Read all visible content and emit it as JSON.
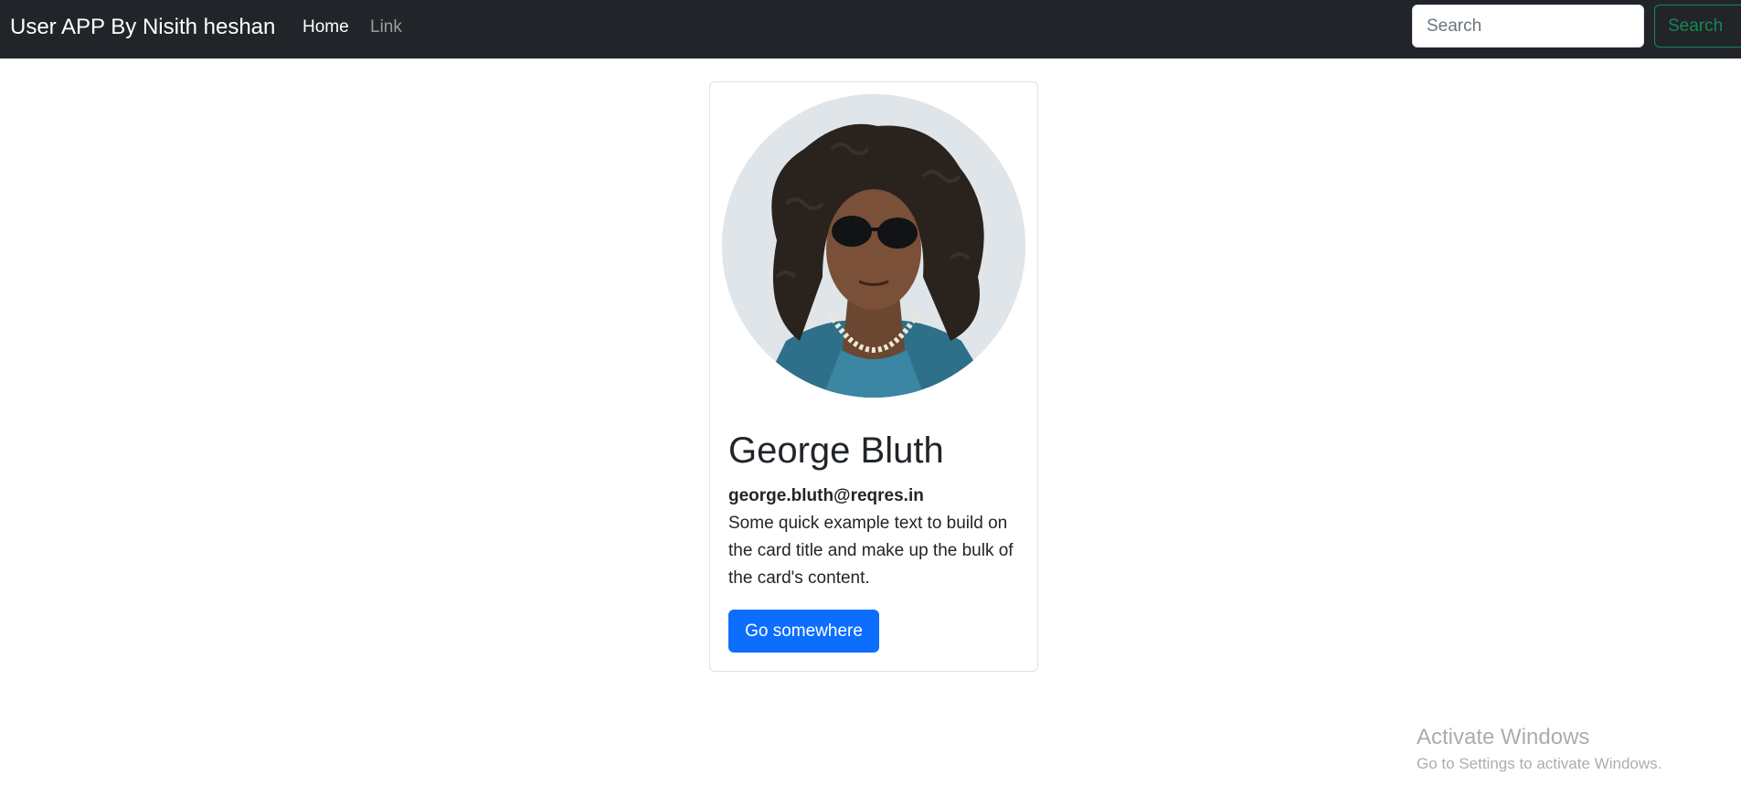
{
  "navbar": {
    "brand": "User APP By Nisith heshan",
    "links": [
      {
        "label": "Home",
        "active": true
      },
      {
        "label": "Link",
        "active": false
      }
    ],
    "search": {
      "placeholder": "Search",
      "value": "",
      "button_label": "Search"
    }
  },
  "card": {
    "avatar_icon": "user-photo",
    "name": "George Bluth",
    "email": "george.bluth@reqres.in",
    "text": "Some quick example text to build on the card title and make up the bulk of the card's content.",
    "button_label": "Go somewhere"
  },
  "watermark": {
    "title": "Activate Windows",
    "subtitle": "Go to Settings to activate Windows."
  },
  "colors": {
    "navbar_bg": "#212529",
    "primary": "#0d6efd",
    "success": "#198754"
  }
}
